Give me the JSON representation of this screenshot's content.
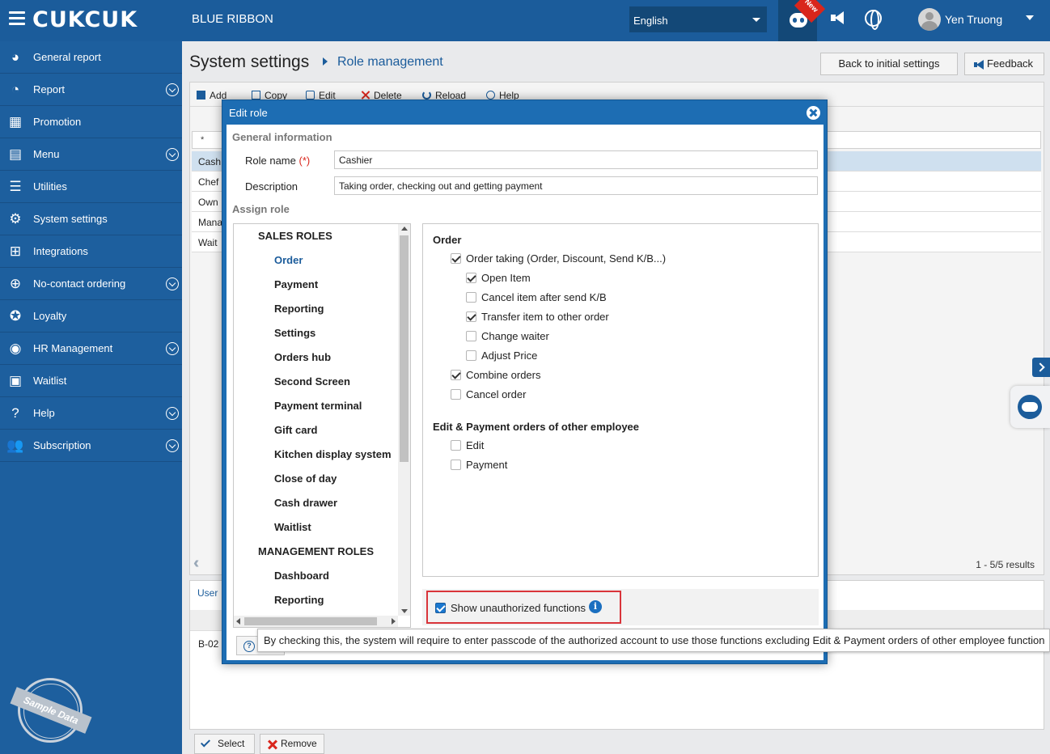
{
  "topbar": {
    "logo": "CUKCUK",
    "restaurant": "BLUE RIBBON",
    "language": "English",
    "new_badge": "New",
    "user_name": "Yen Truong"
  },
  "sidebar": {
    "items": [
      {
        "label": "General report",
        "icon": "dashboard-icon",
        "expandable": false
      },
      {
        "label": "Report",
        "icon": "pie-chart-icon",
        "expandable": true
      },
      {
        "label": "Promotion",
        "icon": "gift-icon",
        "expandable": false
      },
      {
        "label": "Menu",
        "icon": "menu-book-icon",
        "expandable": true
      },
      {
        "label": "Utilities",
        "icon": "list-icon",
        "expandable": false
      },
      {
        "label": "System settings",
        "icon": "gear-icon",
        "expandable": false
      },
      {
        "label": "Integrations",
        "icon": "integrations-icon",
        "expandable": false
      },
      {
        "label": "No-contact ordering",
        "icon": "globe-icon",
        "expandable": true
      },
      {
        "label": "Loyalty",
        "icon": "loyalty-icon",
        "expandable": false
      },
      {
        "label": "HR Management",
        "icon": "hr-icon",
        "expandable": true
      },
      {
        "label": "Waitlist",
        "icon": "waitlist-icon",
        "expandable": false
      },
      {
        "label": "Help",
        "icon": "help-icon",
        "expandable": true
      },
      {
        "label": "Subscription",
        "icon": "users-icon",
        "expandable": true
      }
    ],
    "stamp": "Sample Data"
  },
  "main": {
    "title": "System settings",
    "subtitle": "Role management",
    "back_button": "Back to initial settings",
    "feedback_button": "Feedback",
    "toolbar": [
      "Add",
      "Copy",
      "Edit",
      "Delete",
      "Reload",
      "Help"
    ],
    "filter_symbol": "*",
    "rows": [
      "Cash",
      "Chef",
      "Own",
      "Mana",
      "Wait"
    ],
    "pager": "1 - 5/5 results",
    "user_tab": "User",
    "user_row": "B-02",
    "select_button": "Select",
    "remove_button": "Remove"
  },
  "modal": {
    "title": "Edit role",
    "general_info": "General information",
    "role_name_label": "Role name",
    "required_mark": "(*)",
    "role_name_value": "Cashier",
    "description_label": "Description",
    "description_value": "Taking order, checking out and getting payment",
    "assign_role": "Assign role",
    "tree": [
      {
        "label": "SALES ROLES",
        "level": 0,
        "active": false
      },
      {
        "label": "Order",
        "level": 1,
        "active": true
      },
      {
        "label": "Payment",
        "level": 1,
        "active": false
      },
      {
        "label": "Reporting",
        "level": 1,
        "active": false
      },
      {
        "label": "Settings",
        "level": 1,
        "active": false
      },
      {
        "label": "Orders hub",
        "level": 1,
        "active": false
      },
      {
        "label": "Second Screen",
        "level": 1,
        "active": false
      },
      {
        "label": "Payment terminal",
        "level": 1,
        "active": false
      },
      {
        "label": "Gift card",
        "level": 1,
        "active": false
      },
      {
        "label": "Kitchen display system",
        "level": 1,
        "active": false
      },
      {
        "label": "Close of day",
        "level": 1,
        "active": false
      },
      {
        "label": "Cash drawer",
        "level": 1,
        "active": false
      },
      {
        "label": "Waitlist",
        "level": 1,
        "active": false
      },
      {
        "label": "MANAGEMENT ROLES",
        "level": 0,
        "active": false
      },
      {
        "label": "Dashboard",
        "level": 1,
        "active": false
      },
      {
        "label": "Reporting",
        "level": 1,
        "active": false
      }
    ],
    "groups": [
      {
        "title": "Order",
        "items": [
          {
            "label": "Order taking (Order, Discount, Send K/B...)",
            "checked": true,
            "level": 0
          },
          {
            "label": "Open Item",
            "checked": true,
            "level": 1
          },
          {
            "label": "Cancel item after send K/B",
            "checked": false,
            "level": 1
          },
          {
            "label": "Transfer item to other order",
            "checked": true,
            "level": 1
          },
          {
            "label": "Change waiter",
            "checked": false,
            "level": 1
          },
          {
            "label": "Adjust Price",
            "checked": false,
            "level": 1
          },
          {
            "label": "Combine orders",
            "checked": true,
            "level": 0
          },
          {
            "label": "Cancel order",
            "checked": false,
            "level": 0
          }
        ]
      },
      {
        "title": "Edit & Payment orders of other employee",
        "items": [
          {
            "label": "Edit",
            "checked": false,
            "level": 0
          },
          {
            "label": "Payment",
            "checked": false,
            "level": 0
          }
        ]
      }
    ],
    "show_unauthorized": {
      "label": "Show unauthorized functions",
      "checked": true
    },
    "tooltip": "By checking this, the system will require to enter passcode of the authorized account to use those functions excluding Edit & Payment orders of other employee function"
  }
}
